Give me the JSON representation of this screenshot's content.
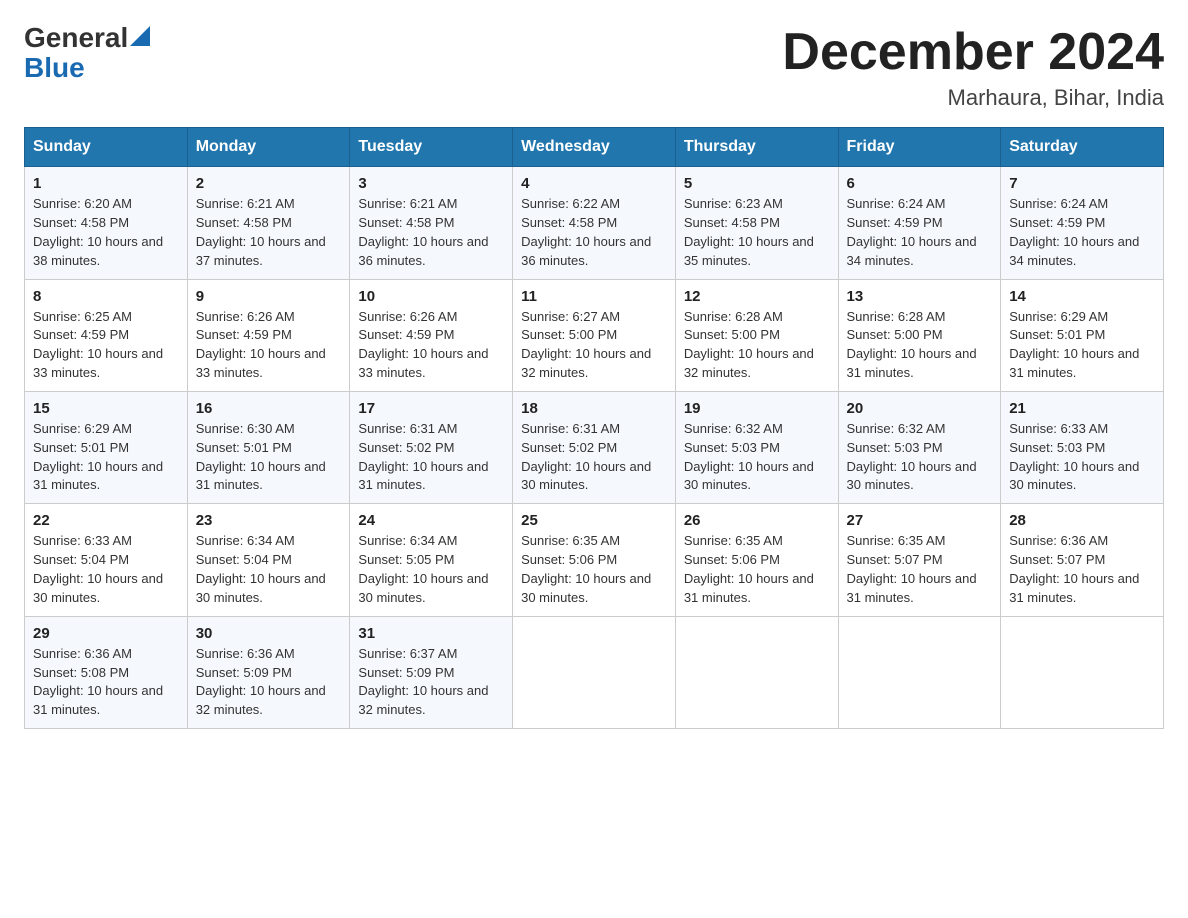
{
  "logo": {
    "general": "General",
    "blue": "Blue"
  },
  "title": "December 2024",
  "location": "Marhaura, Bihar, India",
  "headers": [
    "Sunday",
    "Monday",
    "Tuesday",
    "Wednesday",
    "Thursday",
    "Friday",
    "Saturday"
  ],
  "weeks": [
    [
      {
        "day": "1",
        "sunrise": "6:20 AM",
        "sunset": "4:58 PM",
        "daylight": "10 hours and 38 minutes."
      },
      {
        "day": "2",
        "sunrise": "6:21 AM",
        "sunset": "4:58 PM",
        "daylight": "10 hours and 37 minutes."
      },
      {
        "day": "3",
        "sunrise": "6:21 AM",
        "sunset": "4:58 PM",
        "daylight": "10 hours and 36 minutes."
      },
      {
        "day": "4",
        "sunrise": "6:22 AM",
        "sunset": "4:58 PM",
        "daylight": "10 hours and 36 minutes."
      },
      {
        "day": "5",
        "sunrise": "6:23 AM",
        "sunset": "4:58 PM",
        "daylight": "10 hours and 35 minutes."
      },
      {
        "day": "6",
        "sunrise": "6:24 AM",
        "sunset": "4:59 PM",
        "daylight": "10 hours and 34 minutes."
      },
      {
        "day": "7",
        "sunrise": "6:24 AM",
        "sunset": "4:59 PM",
        "daylight": "10 hours and 34 minutes."
      }
    ],
    [
      {
        "day": "8",
        "sunrise": "6:25 AM",
        "sunset": "4:59 PM",
        "daylight": "10 hours and 33 minutes."
      },
      {
        "day": "9",
        "sunrise": "6:26 AM",
        "sunset": "4:59 PM",
        "daylight": "10 hours and 33 minutes."
      },
      {
        "day": "10",
        "sunrise": "6:26 AM",
        "sunset": "4:59 PM",
        "daylight": "10 hours and 33 minutes."
      },
      {
        "day": "11",
        "sunrise": "6:27 AM",
        "sunset": "5:00 PM",
        "daylight": "10 hours and 32 minutes."
      },
      {
        "day": "12",
        "sunrise": "6:28 AM",
        "sunset": "5:00 PM",
        "daylight": "10 hours and 32 minutes."
      },
      {
        "day": "13",
        "sunrise": "6:28 AM",
        "sunset": "5:00 PM",
        "daylight": "10 hours and 31 minutes."
      },
      {
        "day": "14",
        "sunrise": "6:29 AM",
        "sunset": "5:01 PM",
        "daylight": "10 hours and 31 minutes."
      }
    ],
    [
      {
        "day": "15",
        "sunrise": "6:29 AM",
        "sunset": "5:01 PM",
        "daylight": "10 hours and 31 minutes."
      },
      {
        "day": "16",
        "sunrise": "6:30 AM",
        "sunset": "5:01 PM",
        "daylight": "10 hours and 31 minutes."
      },
      {
        "day": "17",
        "sunrise": "6:31 AM",
        "sunset": "5:02 PM",
        "daylight": "10 hours and 31 minutes."
      },
      {
        "day": "18",
        "sunrise": "6:31 AM",
        "sunset": "5:02 PM",
        "daylight": "10 hours and 30 minutes."
      },
      {
        "day": "19",
        "sunrise": "6:32 AM",
        "sunset": "5:03 PM",
        "daylight": "10 hours and 30 minutes."
      },
      {
        "day": "20",
        "sunrise": "6:32 AM",
        "sunset": "5:03 PM",
        "daylight": "10 hours and 30 minutes."
      },
      {
        "day": "21",
        "sunrise": "6:33 AM",
        "sunset": "5:03 PM",
        "daylight": "10 hours and 30 minutes."
      }
    ],
    [
      {
        "day": "22",
        "sunrise": "6:33 AM",
        "sunset": "5:04 PM",
        "daylight": "10 hours and 30 minutes."
      },
      {
        "day": "23",
        "sunrise": "6:34 AM",
        "sunset": "5:04 PM",
        "daylight": "10 hours and 30 minutes."
      },
      {
        "day": "24",
        "sunrise": "6:34 AM",
        "sunset": "5:05 PM",
        "daylight": "10 hours and 30 minutes."
      },
      {
        "day": "25",
        "sunrise": "6:35 AM",
        "sunset": "5:06 PM",
        "daylight": "10 hours and 30 minutes."
      },
      {
        "day": "26",
        "sunrise": "6:35 AM",
        "sunset": "5:06 PM",
        "daylight": "10 hours and 31 minutes."
      },
      {
        "day": "27",
        "sunrise": "6:35 AM",
        "sunset": "5:07 PM",
        "daylight": "10 hours and 31 minutes."
      },
      {
        "day": "28",
        "sunrise": "6:36 AM",
        "sunset": "5:07 PM",
        "daylight": "10 hours and 31 minutes."
      }
    ],
    [
      {
        "day": "29",
        "sunrise": "6:36 AM",
        "sunset": "5:08 PM",
        "daylight": "10 hours and 31 minutes."
      },
      {
        "day": "30",
        "sunrise": "6:36 AM",
        "sunset": "5:09 PM",
        "daylight": "10 hours and 32 minutes."
      },
      {
        "day": "31",
        "sunrise": "6:37 AM",
        "sunset": "5:09 PM",
        "daylight": "10 hours and 32 minutes."
      },
      null,
      null,
      null,
      null
    ]
  ]
}
